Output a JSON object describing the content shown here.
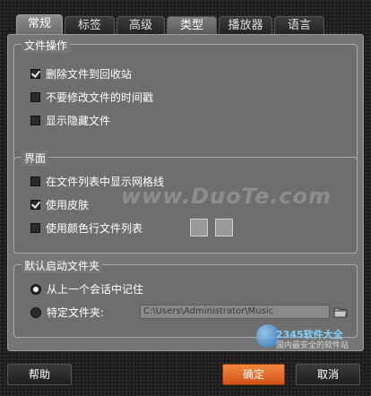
{
  "tabs": [
    {
      "label": "常规",
      "state": "active"
    },
    {
      "label": "标签",
      "state": "normal"
    },
    {
      "label": "高级",
      "state": "normal"
    },
    {
      "label": "类型",
      "state": "highlighted"
    },
    {
      "label": "播放器",
      "state": "normal"
    },
    {
      "label": "语言",
      "state": "normal"
    }
  ],
  "file_ops": {
    "title": "文件操作",
    "options": [
      {
        "label": "删除文件到回收站",
        "checked": true
      },
      {
        "label": "不要修改文件的时间戳",
        "checked": false
      },
      {
        "label": "显示隐藏文件",
        "checked": false
      }
    ]
  },
  "interface": {
    "title": "界面",
    "options": [
      {
        "label": "在文件列表中显示网格线",
        "checked": false
      },
      {
        "label": "使用皮肤",
        "checked": true
      },
      {
        "label": "使用颜色行文件列表",
        "checked": false
      }
    ]
  },
  "default_folder": {
    "title": "默认启动文件夹",
    "options": [
      {
        "label": "从上一个会话中记住",
        "selected": true
      },
      {
        "label": "特定文件夹:",
        "selected": false
      }
    ],
    "path_value": "C:\\Users\\Administrator\\Music"
  },
  "buttons": {
    "help": "帮助",
    "ok": "确定",
    "cancel": "取消"
  },
  "watermark": {
    "text": "www.DuoTe.com",
    "logo": "2345软件大全",
    "tagline": "国内最安全的软件站"
  },
  "colors": {
    "accent": "#e06a2c",
    "panel": "#767676"
  }
}
